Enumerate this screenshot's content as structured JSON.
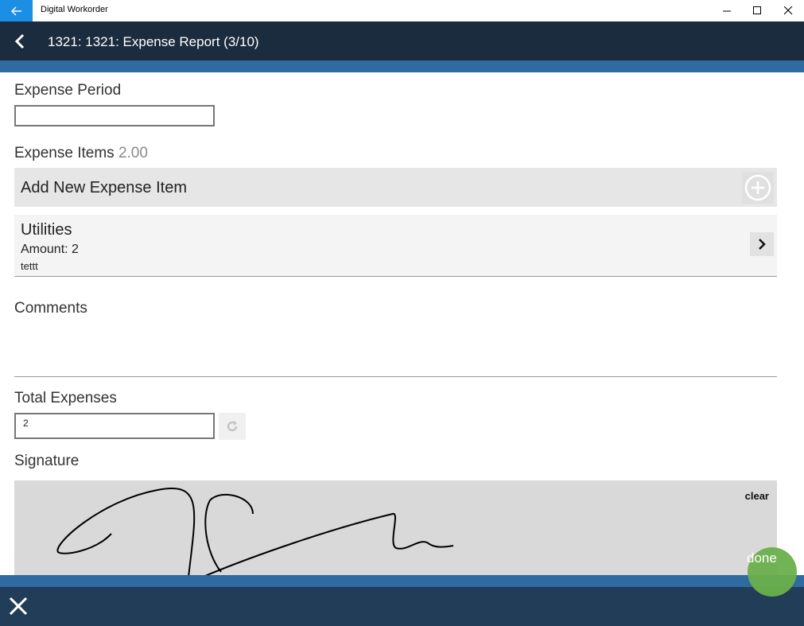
{
  "window": {
    "title": "Digital Workorder"
  },
  "appbar": {
    "title": "1321: 1321: Expense Report (3/10)"
  },
  "form": {
    "expense_period": {
      "label": "Expense Period",
      "value": ""
    },
    "expense_items": {
      "label": "Expense Items",
      "total": "2.00",
      "add_label": "Add New Expense Item",
      "items": [
        {
          "title": "Utilities",
          "amount": "Amount: 2",
          "note": "tettt"
        }
      ]
    },
    "comments": {
      "label": "Comments",
      "value": ""
    },
    "total_expenses": {
      "label": "Total Expenses",
      "value": "2"
    },
    "signature": {
      "label": "Signature",
      "clear_label": "clear"
    }
  },
  "actions": {
    "done_label": "done"
  },
  "colors": {
    "accent": "#1a8fe3",
    "appbar": "#1b2c3e",
    "stripe": "#2f6aa0",
    "done": "#6ab04c"
  },
  "icons": [
    "back-arrow-icon",
    "minimize-icon",
    "maximize-icon",
    "close-icon",
    "chevron-left-icon",
    "plus-circle-icon",
    "chevron-right-icon",
    "refresh-icon",
    "close-x-icon"
  ]
}
